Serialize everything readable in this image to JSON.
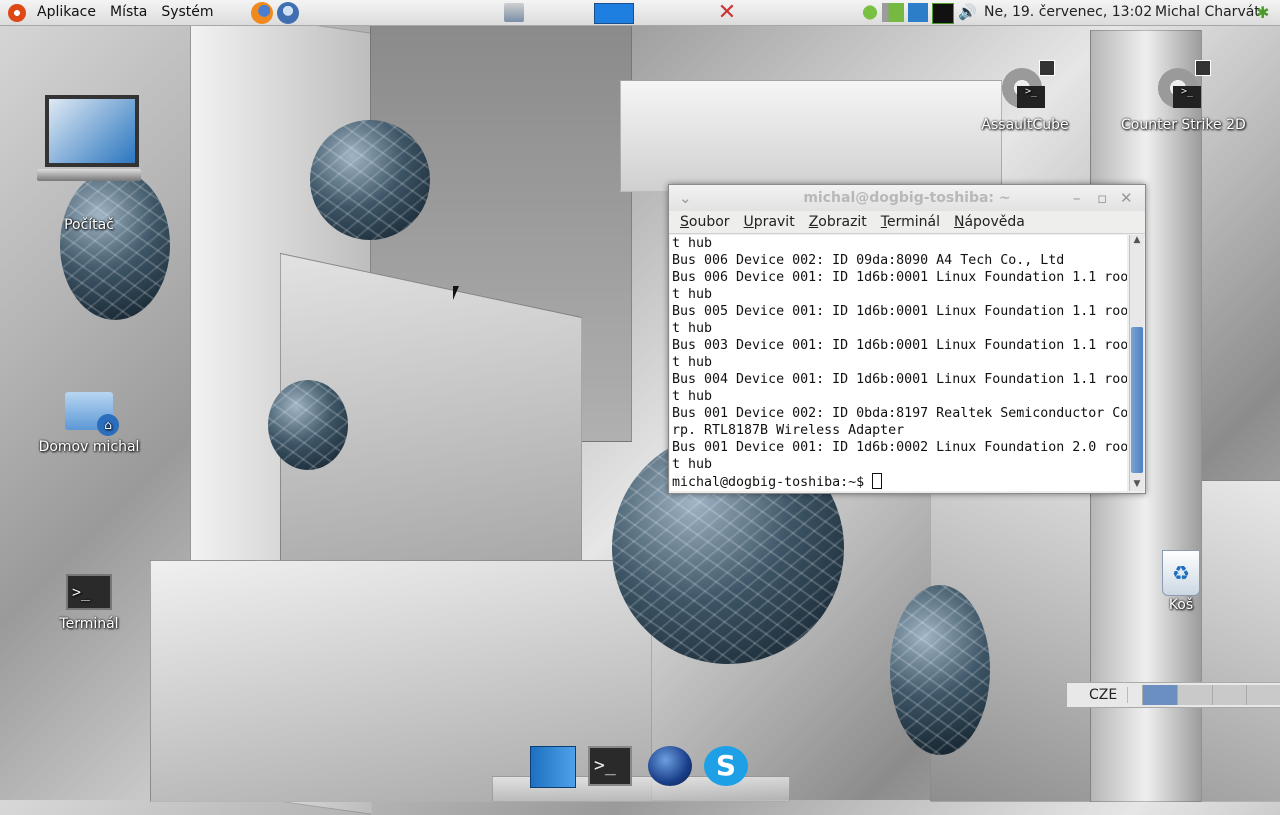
{
  "top_panel": {
    "menus": [
      "Aplikace",
      "Místa",
      "Systém"
    ],
    "launchers": [
      "firefox-icon",
      "thunderbird-icon"
    ],
    "clock": "Ne, 19. červenec, 13:02",
    "user": "Michal Charvát"
  },
  "desktop_icons": {
    "computer": "Počítač",
    "home": "Domov michal",
    "terminal": "Terminál",
    "assaultcube": "AssaultCube",
    "counterstrike": "Counter Strike 2D",
    "trash": "Koš"
  },
  "terminal": {
    "title": "michal@dogbig-toshiba: ~",
    "menu": [
      "Soubor",
      "Upravit",
      "Zobrazit",
      "Terminál",
      "Nápověda"
    ],
    "lines": [
      "t hub",
      "Bus 006 Device 002: ID 09da:8090 A4 Tech Co., Ltd",
      "Bus 006 Device 001: ID 1d6b:0001 Linux Foundation 1.1 roo",
      "t hub",
      "Bus 005 Device 001: ID 1d6b:0001 Linux Foundation 1.1 roo",
      "t hub",
      "Bus 003 Device 001: ID 1d6b:0001 Linux Foundation 1.1 roo",
      "t hub",
      "Bus 004 Device 001: ID 1d6b:0001 Linux Foundation 1.1 roo",
      "t hub",
      "Bus 001 Device 002: ID 0bda:8197 Realtek Semiconductor Co",
      "rp. RTL8187B Wireless Adapter",
      "Bus 001 Device 001: ID 1d6b:0002 Linux Foundation 2.0 roo",
      "t hub"
    ],
    "prompt": "michal@dogbig-toshiba:~$ "
  },
  "workspace": {
    "keyboard": "CZE",
    "count": 4,
    "active": 0
  },
  "dock": {
    "apps": [
      "desktop-icon",
      "terminal-icon",
      "browser-globe-icon",
      "skype-icon"
    ]
  },
  "colors": {
    "panel": "#e6e6e6",
    "accent": "#4d80c2"
  }
}
